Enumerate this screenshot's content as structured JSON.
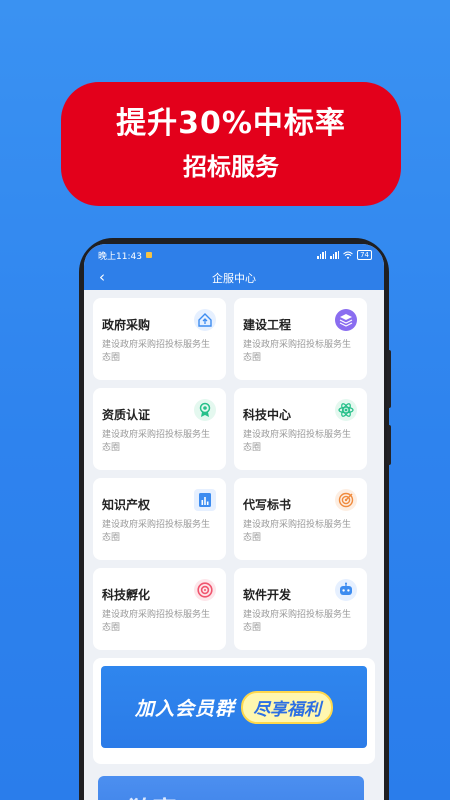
{
  "banner": {
    "title": "提升30%中标率",
    "subtitle": "招标服务"
  },
  "status_bar": {
    "time": "晚上11:43",
    "battery": "74"
  },
  "header": {
    "title": "企服中心",
    "back_label": "‹"
  },
  "services": [
    {
      "title": "政府采购",
      "desc": "建设政府采购招投标服务生态圈",
      "icon": "home-upload-icon",
      "color": "#3d8cf0"
    },
    {
      "title": "建设工程",
      "desc": "建设政府采购招投标服务生态圈",
      "icon": "layers-icon",
      "color": "#8a6df0"
    },
    {
      "title": "资质认证",
      "desc": "建设政府采购招投标服务生态圈",
      "icon": "medal-icon",
      "color": "#27c08a"
    },
    {
      "title": "科技中心",
      "desc": "建设政府采购招投标服务生态圈",
      "icon": "atom-icon",
      "color": "#27c08a"
    },
    {
      "title": "知识产权",
      "desc": "建设政府采购招投标服务生态圈",
      "icon": "document-chart-icon",
      "color": "#3d8cf0"
    },
    {
      "title": "代写标书",
      "desc": "建设政府采购招投标服务生态圈",
      "icon": "target-icon",
      "color": "#f08a3d"
    },
    {
      "title": "科技孵化",
      "desc": "建设政府采购招投标服务生态圈",
      "icon": "disc-icon",
      "color": "#f0556e"
    },
    {
      "title": "软件开发",
      "desc": "建设政府采购招投标服务生态圈",
      "icon": "robot-icon",
      "color": "#3d8cf0"
    }
  ],
  "promo": {
    "main": "加入会员群",
    "pill": "尽享福利"
  },
  "next_card": {
    "text": "独享VIP"
  }
}
